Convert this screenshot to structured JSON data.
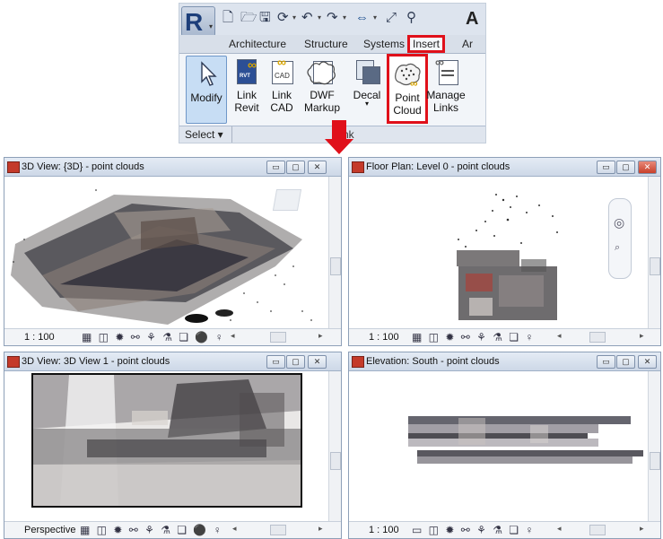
{
  "ribbon": {
    "app_letter": "R",
    "qat_trailing_letter": "A",
    "tabs": {
      "architecture": "Architecture",
      "structure": "Structure",
      "systems": "Systems",
      "insert": "Insert",
      "cut": "Ar"
    },
    "tools": {
      "modify": "Modify",
      "link_revit": "Link\nRevit",
      "link_cad": "Link\nCAD",
      "dwf_markup": "DWF\nMarkup",
      "decal": "Decal",
      "point_cloud": "Point\nCloud",
      "manage_links": "Manage\nLinks"
    },
    "select_label": "Select ▾",
    "panel_label": "nk",
    "highlight_color": "#e0101a"
  },
  "views": {
    "tl": {
      "title": "3D View: {3D} - point clouds",
      "scale": "1 : 100"
    },
    "tr": {
      "title": "Floor Plan: Level 0 - point clouds",
      "scale": "1 : 100"
    },
    "bl": {
      "title": "3D View: 3D View 1 - point clouds",
      "scale": "Perspective"
    },
    "br": {
      "title": "Elevation: South - point clouds",
      "scale": "1 : 100"
    }
  }
}
